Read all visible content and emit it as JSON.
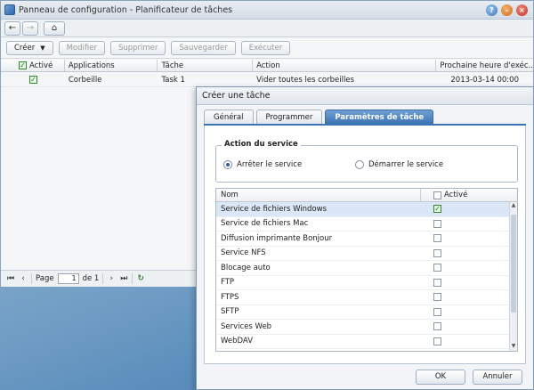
{
  "window": {
    "title": "Panneau de configuration - Planificateur de tâches",
    "buttons": {
      "help": "?",
      "minimize": "–",
      "close": "×"
    }
  },
  "nav": {
    "back": "←",
    "forward": "→",
    "home": "⌂"
  },
  "toolbar": {
    "create": "Créer",
    "modify": "Modifier",
    "delete": "Supprimer",
    "save": "Sauvegarder",
    "run": "Exécuter"
  },
  "grid": {
    "columns": [
      "Activé",
      "Applications",
      "Tâche",
      "Action",
      "Prochaine heure d'exéc..."
    ],
    "rows": [
      {
        "enabled": true,
        "application": "Corbeille",
        "task": "Task 1",
        "action": "Vider toutes les corbeilles",
        "next_run": "2013-03-14 00:00"
      }
    ]
  },
  "pager": {
    "page_label": "Page",
    "page_value": "1",
    "of_label": "de 1",
    "first": "⏮",
    "prev": "‹",
    "next": "›",
    "last": "⏭",
    "refresh": "↻"
  },
  "dialog": {
    "title": "Créer une tâche",
    "tabs": [
      "Général",
      "Programmer",
      "Paramètres de tâche"
    ],
    "active_tab": 2,
    "service_action": {
      "legend": "Action du service",
      "options": [
        "Arrêter le service",
        "Démarrer le service"
      ],
      "selected": 0
    },
    "services": {
      "col_name": "Nom",
      "col_enabled": "Activé",
      "rows": [
        {
          "name": "Service de fichiers Windows",
          "enabled": true
        },
        {
          "name": "Service de fichiers Mac",
          "enabled": false
        },
        {
          "name": "Diffusion imprimante Bonjour",
          "enabled": false
        },
        {
          "name": "Service NFS",
          "enabled": false
        },
        {
          "name": "Blocage auto",
          "enabled": false
        },
        {
          "name": "FTP",
          "enabled": false
        },
        {
          "name": "FTPS",
          "enabled": false
        },
        {
          "name": "SFTP",
          "enabled": false
        },
        {
          "name": "Services Web",
          "enabled": false
        },
        {
          "name": "WebDAV",
          "enabled": false
        }
      ]
    },
    "ok": "OK",
    "cancel": "Annuler"
  }
}
